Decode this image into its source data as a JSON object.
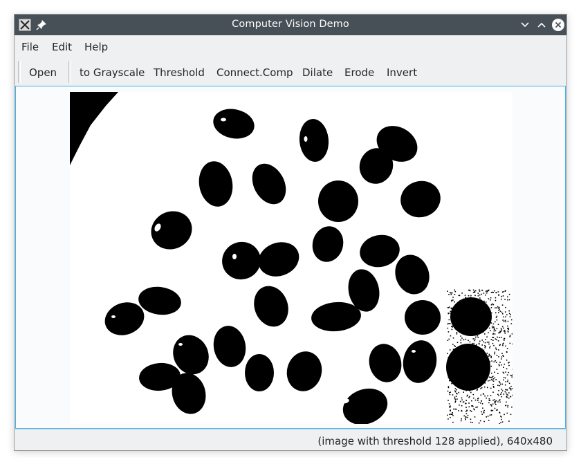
{
  "window": {
    "title": "Computer Vision Demo",
    "app_icon": "x-app-icon",
    "pin_icon": "pin-icon",
    "controls": [
      "minimize-icon",
      "maximize-icon",
      "close-icon"
    ]
  },
  "menu": {
    "file": "File",
    "edit": "Edit",
    "help": "Help"
  },
  "toolbar": {
    "open": "Open",
    "grayscale": "to Grayscale",
    "threshold": "Threshold",
    "connect_comp": "Connect.Comp",
    "dilate": "Dilate",
    "erode": "Erode",
    "invert": "Invert"
  },
  "status": {
    "message": "(image with threshold 128 applied), 640x480"
  },
  "colors": {
    "titlebar": "#475057",
    "window_bg": "#eff0f1",
    "canvas_border": "#3daee9",
    "image_fg": "#000000",
    "image_bg": "#ffffff"
  }
}
